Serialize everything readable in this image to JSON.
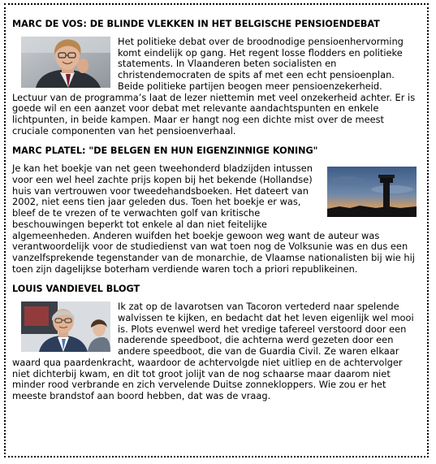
{
  "articles": [
    {
      "headline": "MARC DE VOS: DE BLINDE VLEKKEN IN HET BELGISCHE PENSIOENDEBAT",
      "body": "Het politieke debat over de broodnodige pensioenhervorming komt eindelijk op gang. Het regent losse flodders en politieke statements. In Vlaanderen beten socialisten en christendemocraten de spits af met een echt pensioenplan. Beide politieke partijen beogen meer pensioenzekerheid. Lectuur van de programma’s laat de lezer niettemin met veel onzekerheid achter. Er is goede wil en een aanzet voor debat met relevante aandachtspunten en enkele lichtpunten, in beide kampen. Maar er hangt nog een dichte mist over de meest cruciale componenten van het pensioenverhaal.",
      "photo_icon": "portrait-man-glasses-icon"
    },
    {
      "headline": "MARC PLATEL: \"DE BELGEN EN HUN EIGENZINNIGE KONING\"",
      "body": "Je kan het boekje van net geen tweehonderd bladzijden intussen voor een wel heel zachte prijs kopen bij het bekende (Hollandse) huis van vertrouwen voor tweedehandsboeken. Het dateert van 2002, niet eens tien jaar geleden dus. Toen het boekje er was, bleef de te vrezen of te verwachten golf van kritische beschouwingen beperkt tot enkele al dan niet feitelijke algemeenheden. Anderen wuifden het boekje gewoon weg want de auteur was verantwoordelijk voor de studiedienst van wat toen nog de Volksunie was en dus een vanzelfsprekende tegenstander van de monarchie, de Vlaamse nationalisten bij wie hij toen zijn dagelijkse boterham verdiende waren toch a priori republikeinen.",
      "photo_icon": "water-tower-sunset-icon"
    },
    {
      "headline": "LOUIS VANDIEVEL BLOGT",
      "body": "Ik zat op de lavarotsen van Tacoron vertederd naar spelende walvissen te kijken, en bedacht dat het leven eigenlijk wel mooi is. Plots evenwel werd het vredige tafereel verstoord door een naderende speedboot, die achterna werd gezeten door een andere speedboot, die van de Guardia Civil. Ze waren elkaar waard qua paardenkracht, waardoor de achtervolgde niet uitliep en de achtervolger niet dichterbij kwam, en dit tot groot jolijt van de nog schaarse maar daarom niet minder rood verbrande en zich vervelende Duitse zonnekloppers. Wie zou er het meeste brandstof aan boord hebben, dat was de vraag.",
      "photo_icon": "portrait-man-tv-studio-icon"
    }
  ]
}
